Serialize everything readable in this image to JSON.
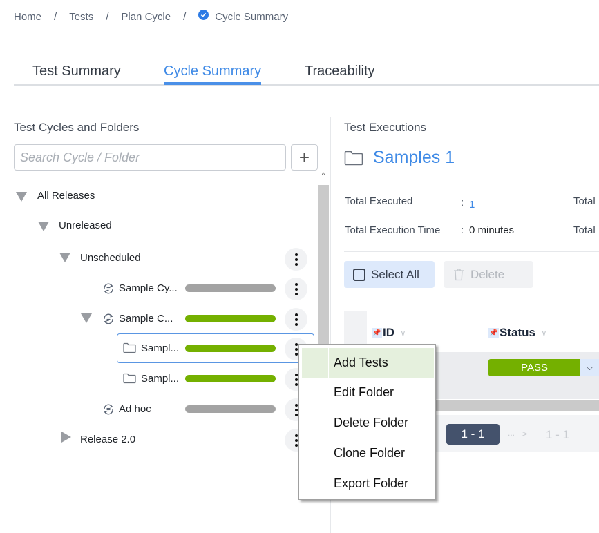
{
  "breadcrumb": {
    "items": [
      "Home",
      "Tests",
      "Plan Cycle"
    ],
    "current": "Cycle Summary",
    "separator": "/"
  },
  "tabs": [
    {
      "label": "Test Summary",
      "active": false
    },
    {
      "label": "Cycle Summary",
      "active": true
    },
    {
      "label": "Traceability",
      "active": false
    }
  ],
  "left_panel": {
    "title": "Test Cycles and Folders",
    "search_placeholder": "Search Cycle / Folder",
    "add_icon": "+",
    "tree": [
      {
        "label": "All Releases",
        "type": "release-group",
        "expanded": true
      },
      {
        "label": "Unreleased",
        "type": "release",
        "expanded": true
      },
      {
        "label": "Unscheduled",
        "type": "schedule",
        "expanded": true
      },
      {
        "label": "Sample Cy...",
        "type": "cycle",
        "progress_status": "not-executed"
      },
      {
        "label": "Sample C...",
        "type": "cycle",
        "expanded": true,
        "progress_status": "pass"
      },
      {
        "label": "Sampl...",
        "type": "folder",
        "selected": true,
        "progress_status": "pass"
      },
      {
        "label": "Sampl...",
        "type": "folder",
        "progress_status": "pass"
      },
      {
        "label": "Ad hoc",
        "type": "cycle",
        "progress_status": "not-executed"
      },
      {
        "label": "Release 2.0",
        "type": "release",
        "expanded": false
      }
    ]
  },
  "right_panel": {
    "title": "Test Executions",
    "folder_name": "Samples 1",
    "stats": {
      "total_executed_label": "Total Executed",
      "total_executed_value": "1",
      "total_exec_time_label": "Total Execution Time",
      "total_exec_time_value": "0 minutes",
      "col2_label_1": "Total",
      "col2_label_2": "Total",
      "colon": ":"
    },
    "select_all_label": "Select All",
    "delete_label": "Delete",
    "columns": [
      {
        "label": "ID",
        "pinned": true
      },
      {
        "label": "Status",
        "pinned": true
      }
    ],
    "rows": [
      {
        "status": "PASS"
      }
    ],
    "pagination": {
      "current": "1 - 1",
      "ellipsis": "...",
      "next": ">",
      "last": "1 - 1"
    }
  },
  "context_menu": {
    "items": [
      "Add Tests",
      "Edit Folder",
      "Delete Folder",
      "Clone Folder",
      "Export Folder"
    ],
    "highlighted": "Add Tests"
  },
  "colors": {
    "accent": "#3f8ae6",
    "pass": "#74b000",
    "not_executed": "#a3a3a3",
    "menu_highlight": "#e5f0dd",
    "pager_active": "#44526c"
  }
}
